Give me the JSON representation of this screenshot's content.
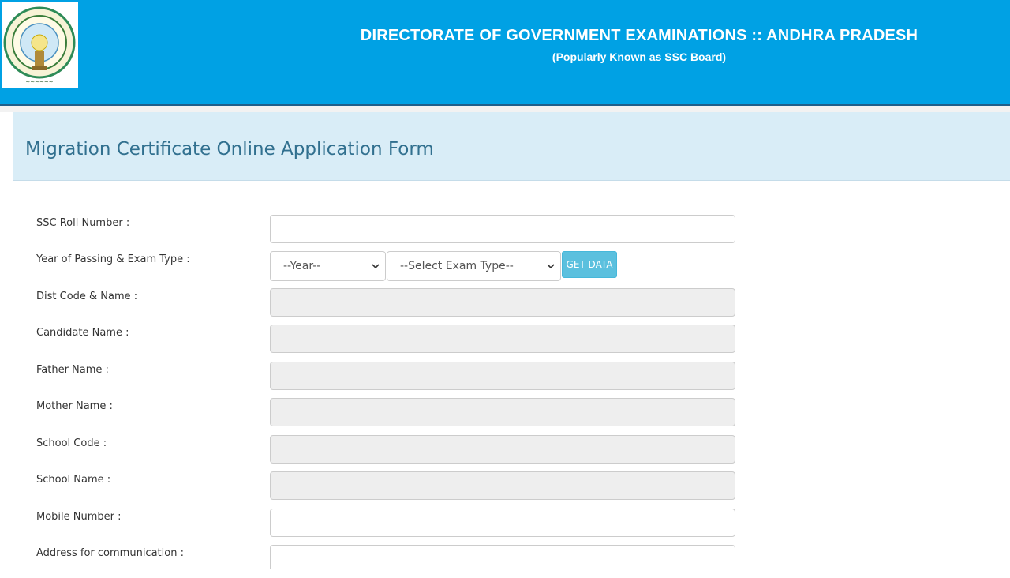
{
  "header": {
    "title": "DIRECTORATE OF GOVERNMENT EXAMINATIONS :: ANDHRA PRADESH",
    "subtitle": "(Popularly Known as SSC Board)",
    "logo_icon": "andhra-pradesh-emblem"
  },
  "form": {
    "title": "Migration Certificate Online Application Form",
    "labels": {
      "roll": "SSC Roll Number :",
      "year_exam": "Year of Passing & Exam Type :",
      "dist": "Dist Code & Name :",
      "candidate": "Candidate Name :",
      "father": "Father Name :",
      "mother": "Mother Name :",
      "school_code": "School Code :",
      "school_name": "School Name :",
      "mobile": "Mobile Number :",
      "address": "Address for communication :"
    },
    "year_select": "--Year--",
    "exam_select": "--Select Exam Type--",
    "get_data_button": "GET DATA"
  },
  "colors": {
    "header_bg": "#00a1e4",
    "panel_head_bg": "#d9edf7",
    "title_color": "#31708f",
    "button_bg": "#5bc0de"
  }
}
